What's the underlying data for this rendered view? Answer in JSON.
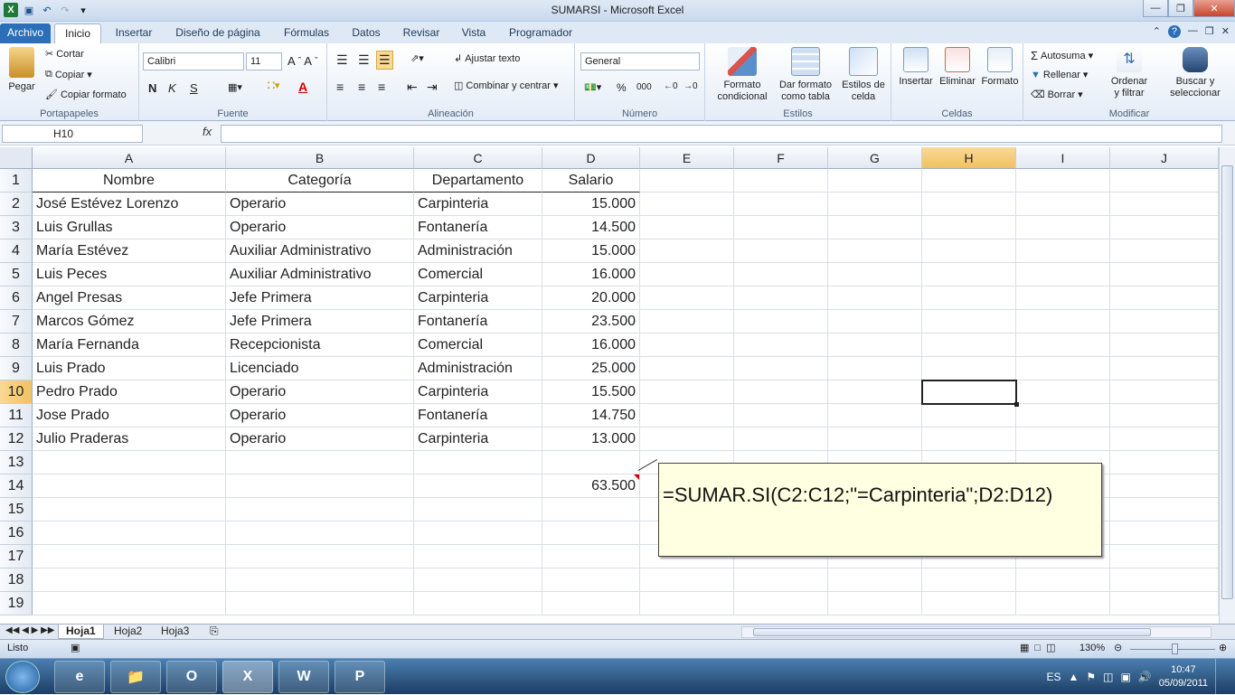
{
  "window": {
    "title": "SUMARSI -  Microsoft Excel"
  },
  "tabs": [
    "Archivo",
    "Inicio",
    "Insertar",
    "Diseño de página",
    "Fórmulas",
    "Datos",
    "Revisar",
    "Vista",
    "Programador"
  ],
  "ribbon": {
    "portapapeles": {
      "paste": "Pegar",
      "cut": "Cortar",
      "copy": "Copiar",
      "format_painter": "Copiar formato",
      "label": "Portapapeles"
    },
    "fuente": {
      "font": "Calibri",
      "size": "11",
      "bold": "N",
      "italic": "K",
      "underline": "S",
      "label": "Fuente"
    },
    "alineacion": {
      "wrap": "Ajustar texto",
      "merge": "Combinar y centrar",
      "label": "Alineación"
    },
    "numero": {
      "format": "General",
      "percent": "%",
      "thousands": "000",
      "label": "Número"
    },
    "estilos": {
      "conditional_1": "Formato",
      "conditional_2": "condicional",
      "table_1": "Dar formato",
      "table_2": "como tabla",
      "cell_1": "Estilos de",
      "cell_2": "celda",
      "label": "Estilos"
    },
    "celdas": {
      "insert": "Insertar",
      "delete": "Eliminar",
      "format": "Formato",
      "label": "Celdas"
    },
    "modificar": {
      "autosum": "Autosuma",
      "fill": "Rellenar",
      "clear": "Borrar",
      "sort_1": "Ordenar",
      "sort_2": "y filtrar",
      "find_1": "Buscar y",
      "find_2": "seleccionar",
      "label": "Modificar"
    }
  },
  "formula_bar": {
    "name_box": "H10",
    "fx": "fx",
    "formula": ""
  },
  "columns": [
    "A",
    "B",
    "C",
    "D",
    "E",
    "F",
    "G",
    "H",
    "I",
    "J"
  ],
  "rows": [
    "1",
    "2",
    "3",
    "4",
    "5",
    "6",
    "7",
    "8",
    "9",
    "10",
    "11",
    "12",
    "13",
    "14",
    "15",
    "16",
    "17",
    "18",
    "19"
  ],
  "table": {
    "headers": [
      "Nombre",
      "Categoría",
      "Departamento",
      "Salario"
    ],
    "data": [
      [
        "José Estévez Lorenzo",
        "Operario",
        "Carpinteria",
        "15.000"
      ],
      [
        "Luis Grullas",
        "Operario",
        "Fontanería",
        "14.500"
      ],
      [
        "María Estévez",
        "Auxiliar Administrativo",
        "Administración",
        "15.000"
      ],
      [
        "Luis Peces",
        "Auxiliar Administrativo",
        "Comercial",
        "16.000"
      ],
      [
        "Angel Presas",
        "Jefe Primera",
        "Carpinteria",
        "20.000"
      ],
      [
        "Marcos Gómez",
        "Jefe Primera",
        "Fontanería",
        "23.500"
      ],
      [
        "María Fernanda",
        "Recepcionista",
        "Comercial",
        "16.000"
      ],
      [
        "Luis Prado",
        "Licenciado",
        "Administración",
        "25.000"
      ],
      [
        "Pedro Prado",
        "Operario",
        "Carpinteria",
        "15.500"
      ],
      [
        "Jose Prado",
        "Operario",
        "Fontanería",
        "14.750"
      ],
      [
        "Julio Praderas",
        "Operario",
        "Carpinteria",
        "13.000"
      ]
    ],
    "total": "63.500"
  },
  "comment": "=SUMAR.SI(C2:C12;\"=Carpinteria\";D2:D12)",
  "sheets": [
    "Hoja1",
    "Hoja2",
    "Hoja3"
  ],
  "status": {
    "ready": "Listo",
    "zoom": "130%"
  },
  "taskbar": {
    "lang": "ES",
    "time": "10:47",
    "date": "05/09/2011"
  }
}
